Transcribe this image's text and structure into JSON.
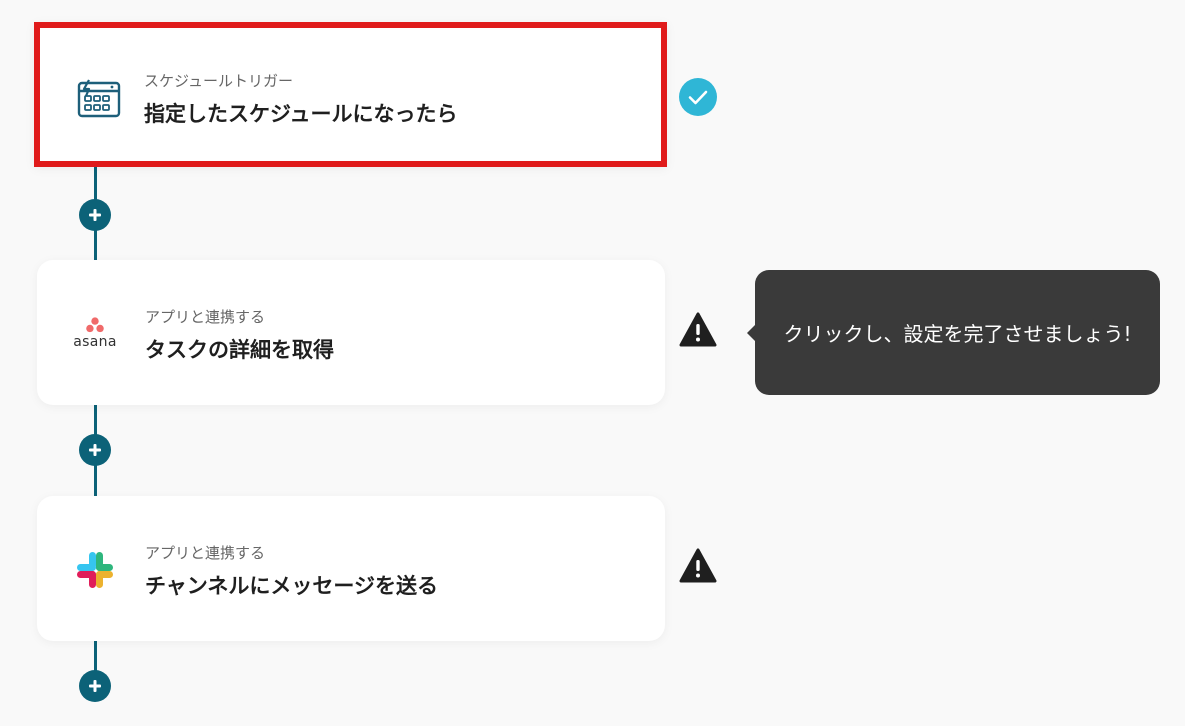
{
  "flow": {
    "steps": [
      {
        "id": "schedule-trigger",
        "subtitle": "スケジュールトリガー",
        "title": "指定したスケジュールになったら",
        "icon": "schedule-calendar-icon",
        "status": "complete",
        "selected": true
      },
      {
        "id": "asana",
        "subtitle": "アプリと連携する",
        "title": "タスクの詳細を取得",
        "icon": "asana-logo-icon",
        "logo_text": "asana",
        "status": "warning",
        "selected": false
      },
      {
        "id": "slack",
        "subtitle": "アプリと連携する",
        "title": "チャンネルにメッセージを送る",
        "icon": "slack-logo-icon",
        "status": "warning",
        "selected": false
      }
    ],
    "tooltip": {
      "text": "クリックし、設定を完了させましょう!"
    }
  },
  "colors": {
    "background": "#f9f9f9",
    "connector": "#0c6278",
    "selection_border": "#e01b1b",
    "complete_badge": "#2fb6d6",
    "warning_icon": "#1f1f1f",
    "tooltip_bg": "#3a3a3a",
    "asana_dots": "#f06a6a",
    "slack_colors": [
      "#36c5f0",
      "#2eb67d",
      "#ecb22e",
      "#e01e5a"
    ]
  }
}
